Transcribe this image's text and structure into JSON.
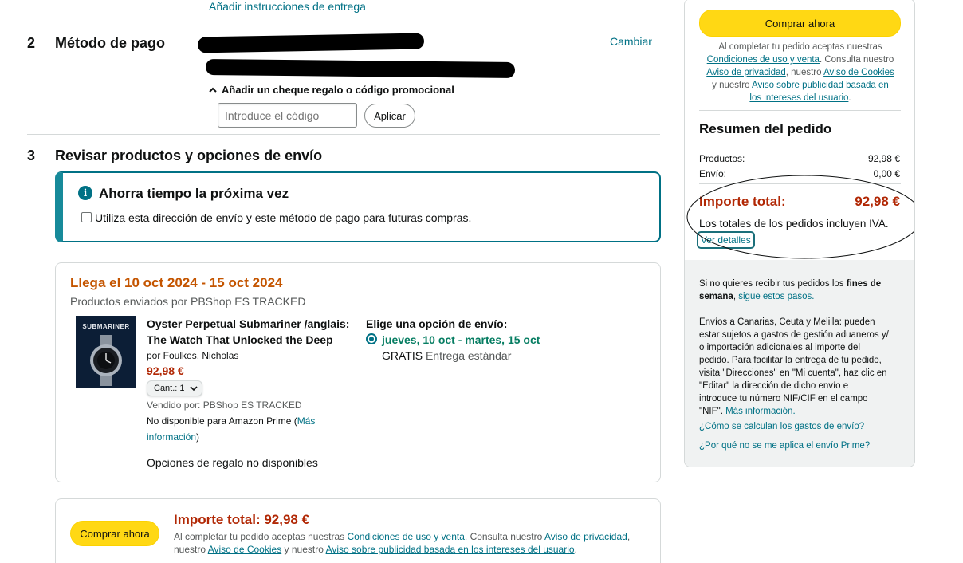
{
  "delivery": {
    "add_instructions_link": "Añadir instrucciones de entrega"
  },
  "payment": {
    "step": "2",
    "title": "Método de pago",
    "change_link": "Cambiar",
    "promo_toggle": "Añadir un cheque regalo o código promocional",
    "promo_placeholder": "Introduce el código",
    "apply_button": "Aplicar"
  },
  "review": {
    "step": "3",
    "title": "Revisar productos y opciones de envío",
    "info_box": {
      "title": "Ahorra tiempo la próxima vez",
      "checkbox_label": "Utiliza esta dirección de envío y este método de pago para futuras compras."
    },
    "shipment": {
      "arrival": "Llega el 10 oct 2024 - 15 oct 2024",
      "shipped_by": "Productos enviados por PBShop ES TRACKED",
      "product": {
        "cover_title": "SUBMARINER",
        "title_line1": "Oyster Perpetual Submariner /anglais:",
        "title_line2": "The Watch That Unlocked the Deep",
        "author": "por Foulkes, Nicholas",
        "price": "92,98 €",
        "qty_label": "Cant.: 1",
        "sold_by": "Vendido por: PBShop ES TRACKED",
        "prime_note": "No disponible para Amazon Prime (",
        "prime_more": "Más",
        "prime_more2": "información",
        "prime_close": ")",
        "gift_options": "Opciones de regalo no disponibles"
      },
      "shipping_options": {
        "title": "Elige una opción de envío:",
        "selected_date": "jueves, 10 oct - martes, 15 oct",
        "free": "GRATIS",
        "method": "Entrega estándar"
      }
    }
  },
  "bottom": {
    "buy_button": "Comprar ahora",
    "total_label": "Importe total:",
    "total_value": "92,98 €",
    "legal_1": "Al completar tu pedido aceptas nuestras",
    "link_conditions": "Condiciones de uso y venta",
    "legal_2": ". Consulta nuestro",
    "link_privacy": "Aviso de privacidad",
    "legal_3": ",",
    "legal_4": "nuestro",
    "link_cookies": "Aviso de Cookies",
    "legal_5": "y nuestro",
    "link_ads": "Aviso sobre publicidad basada en los intereses del usuario",
    "legal_6": "."
  },
  "sidebar": {
    "buy_button": "Comprar ahora",
    "legal_1": "Al completar tu pedido aceptas nuestras",
    "link_conditions": "Condiciones de uso y venta",
    "legal_2": ". Consulta nuestro",
    "link_privacy": "Aviso de privacidad",
    "legal_3": ", nuestro",
    "link_cookies": "Aviso de Cookies",
    "legal_4": "y nuestro",
    "link_ads_1": "Aviso sobre publicidad basada en",
    "link_ads_2": "los intereses del usuario",
    "legal_5": ".",
    "summary_title": "Resumen del pedido",
    "products_label": "Productos:",
    "products_value": "92,98 €",
    "shipping_label": "Envío:",
    "shipping_value": "0,00 €",
    "total_label": "Importe total:",
    "total_value": "92,98 €",
    "vat_note": "Los totales de los pedidos incluyen IVA.",
    "details_link": "Ver detalles",
    "weekend_1": "Si no quieres recibir tus pedidos los",
    "weekend_bold_1": "fines de",
    "weekend_bold_2": "semana",
    "weekend_2": ",",
    "weekend_link": "sigue estos pasos.",
    "canarias_lines": [
      "Envíos a Canarias, Ceuta y Melilla: pueden",
      "estar sujetos a gastos de gestión aduaneros y/",
      "o importación adicionales al importe del",
      "pedido. Para facilitar la entrega de tu pedido,",
      "visita \"Direcciones\" en \"Mi cuenta\", haz clic en",
      "\"Editar\" la dirección de dicho envío e",
      "introduce tu número NIF/CIF en el campo"
    ],
    "canarias_last": "\"NIF\".",
    "more_info_link": "Más información.",
    "shipping_cost_link": "¿Cómo se calculan los gastos de envío?",
    "prime_link": "¿Por qué no se me aplica el envío Prime?"
  },
  "colors": {
    "link": "#007185",
    "price_red": "#b12704",
    "arrival_orange": "#c45500",
    "green": "#067d62",
    "yellow_button": "#ffd814"
  }
}
